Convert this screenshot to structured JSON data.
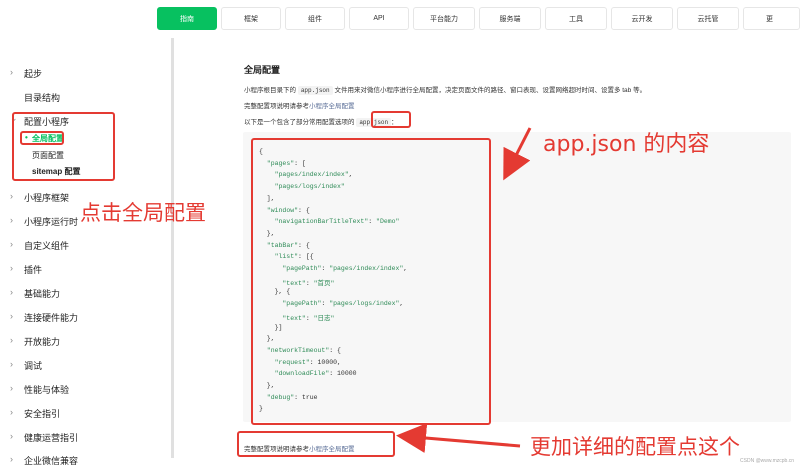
{
  "topnav": {
    "tabs": [
      {
        "label": "指南",
        "active": true
      },
      {
        "label": "框架"
      },
      {
        "label": "组件"
      },
      {
        "label": "API"
      },
      {
        "label": "平台能力"
      },
      {
        "label": "服务端"
      },
      {
        "label": "工具"
      },
      {
        "label": "云开发"
      },
      {
        "label": "云托管"
      },
      {
        "label": "更"
      }
    ]
  },
  "sidebar": {
    "items": [
      {
        "label": "起步",
        "chevron": "›"
      },
      {
        "label": "目录结构"
      },
      {
        "label": "配置小程序",
        "chevron": "⌄"
      },
      {
        "label": "小程序框架",
        "chevron": "›"
      },
      {
        "label": "小程序运行时",
        "chevron": "›"
      },
      {
        "label": "自定义组件",
        "chevron": "›"
      },
      {
        "label": "插件",
        "chevron": "›"
      },
      {
        "label": "基础能力",
        "chevron": "›"
      },
      {
        "label": "连接硬件能力",
        "chevron": "›"
      },
      {
        "label": "开放能力",
        "chevron": "›"
      },
      {
        "label": "调试",
        "chevron": "›"
      },
      {
        "label": "性能与体验",
        "chevron": "›"
      },
      {
        "label": "安全指引",
        "chevron": "›"
      },
      {
        "label": "健康运营指引",
        "chevron": "›"
      },
      {
        "label": "企业微信兼容",
        "chevron": "›"
      }
    ],
    "subitems": [
      {
        "label": "全局配置",
        "active": true
      },
      {
        "label": "页面配置"
      },
      {
        "label": "sitemap 配置"
      }
    ]
  },
  "main": {
    "title": "全局配置",
    "para1_pre": "小程序根目录下的",
    "para1_code": "app.json",
    "para1_post": "文件用来对微信小程序进行全局配置，决定页面文件的路径、窗口表现、设置网络超时时间、设置多 tab 等。",
    "para2_pre": "完整配置项说明请参考",
    "para2_link": "小程序全局配置",
    "para3_pre": "以下是一个包含了部分常用配置选项的",
    "para3_code": "app.json",
    "para3_post": "：",
    "bottom_pre": "完整配置项说明请参考",
    "bottom_link": "小程序全局配置"
  },
  "code_lines": [
    "{",
    "  \"pages\": [",
    "    \"pages/index/index\",",
    "    \"pages/logs/index\"",
    "  ],",
    "  \"window\": {",
    "    \"navigationBarTitleText\": \"Demo\"",
    "  },",
    "  \"tabBar\": {",
    "    \"list\": [{",
    "      \"pagePath\": \"pages/index/index\",",
    "      \"text\": \"首页\"",
    "    }, {",
    "      \"pagePath\": \"pages/logs/index\",",
    "      \"text\": \"日志\"",
    "    }]",
    "  },",
    "  \"networkTimeout\": {",
    "    \"request\": 10000,",
    "    \"downloadFile\": 10000",
    "  },",
    "  \"debug\": true",
    "}"
  ],
  "annotations": {
    "click_global": "点击全局配置",
    "app_json": "app.json 的内容",
    "more_detail": "更加详细的配置点这个"
  },
  "watermark": "CSDN @www.mzcpb.cn",
  "colors": {
    "accent": "#07c160",
    "annotation": "#e43a32",
    "link": "#576b95"
  }
}
